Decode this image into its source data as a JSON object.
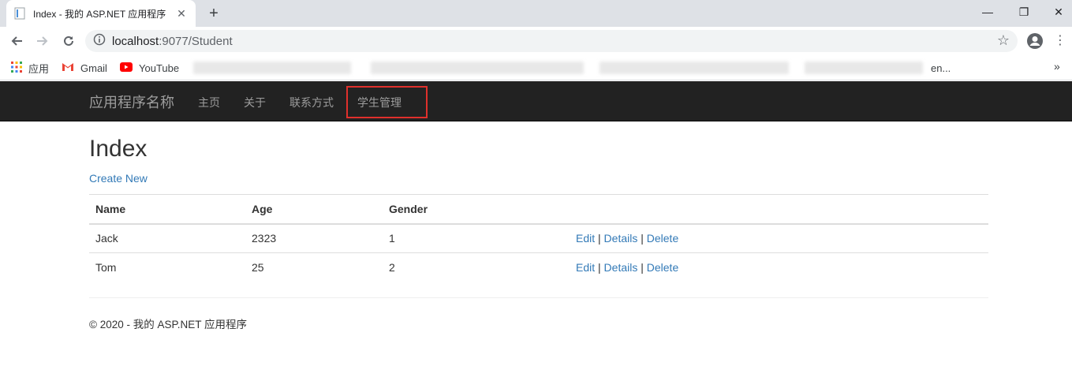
{
  "browser": {
    "tab_title": "Index - 我的 ASP.NET 应用程序",
    "url_host": "localhost",
    "url_path": ":9077/Student",
    "bookmarks": [
      {
        "label": "应用",
        "icon": "apps-grid-icon"
      },
      {
        "label": "Gmail",
        "icon": "gmail-icon"
      },
      {
        "label": "YouTube",
        "icon": "youtube-icon"
      }
    ],
    "bookmark_tail": "en..."
  },
  "navbar": {
    "brand": "应用程序名称",
    "links": [
      "主页",
      "关于",
      "联系方式",
      "学生管理"
    ]
  },
  "main": {
    "title": "Index",
    "create_link": "Create New",
    "table": {
      "headers": [
        "Name",
        "Age",
        "Gender"
      ],
      "rows": [
        {
          "name": "Jack",
          "age": "2323",
          "gender": "1"
        },
        {
          "name": "Tom",
          "age": "25",
          "gender": "2"
        }
      ],
      "actions": {
        "edit": "Edit",
        "details": "Details",
        "delete": "Delete",
        "separator": "|"
      }
    }
  },
  "footer": {
    "text": "© 2020 - 我的 ASP.NET 应用程序"
  },
  "colors": {
    "navbar_bg": "#222222",
    "link": "#337ab7",
    "highlight_border": "#e0302c"
  }
}
